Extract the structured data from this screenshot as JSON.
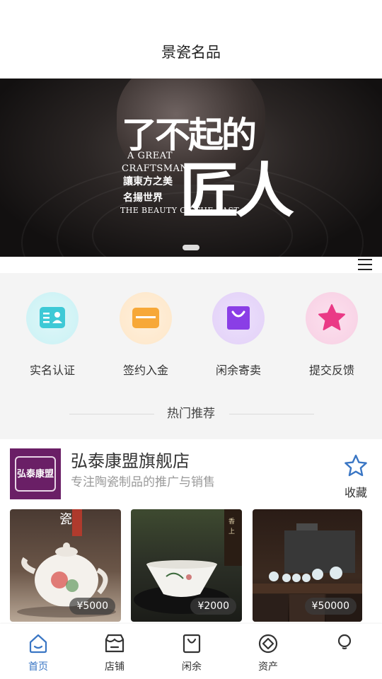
{
  "header": {
    "title": "景瓷名品"
  },
  "banner": {
    "slogan_main": "了不起的",
    "slogan_en1": "A GREAT",
    "slogan_en2": "CRAFTSMAN",
    "slogan_big": "匠人",
    "slogan_cn1": "讓東方之美",
    "slogan_cn2": "名揚世界",
    "slogan_en3": "THE BEAUTY OF THE EAST"
  },
  "quick_actions": [
    {
      "label": "实名认证",
      "icon": "id-card-icon",
      "color": "#3ec9d6"
    },
    {
      "label": "签约入金",
      "icon": "card-icon",
      "color": "#f7a838"
    },
    {
      "label": "闲余寄卖",
      "icon": "shopping-bag-icon",
      "color": "#8a3ee6"
    },
    {
      "label": "提交反馈",
      "icon": "star-icon",
      "color": "#ea3a86"
    }
  ],
  "section": {
    "title": "热门推荐"
  },
  "store": {
    "logo_text": "弘泰康盟",
    "name": "弘泰康盟旗舰店",
    "description": "专注陶瓷制品的推广与销售",
    "favorite_label": "收藏"
  },
  "products": [
    {
      "price": "¥5000",
      "image": "teapot-image"
    },
    {
      "price": "¥2000",
      "image": "bowl-image"
    },
    {
      "price": "¥50000",
      "image": "tea-set-image"
    }
  ],
  "tabs": [
    {
      "label": "首页",
      "icon": "home-icon",
      "active": true
    },
    {
      "label": "店铺",
      "icon": "store-icon"
    },
    {
      "label": "闲余",
      "icon": "bag-icon"
    },
    {
      "label": "资产",
      "icon": "asset-icon"
    },
    {
      "label": "",
      "icon": "profile-icon"
    }
  ],
  "colors": {
    "accent": "#3a76c4",
    "store_logo": "#6a1f66",
    "quick_bg": "#f4f4f4"
  }
}
